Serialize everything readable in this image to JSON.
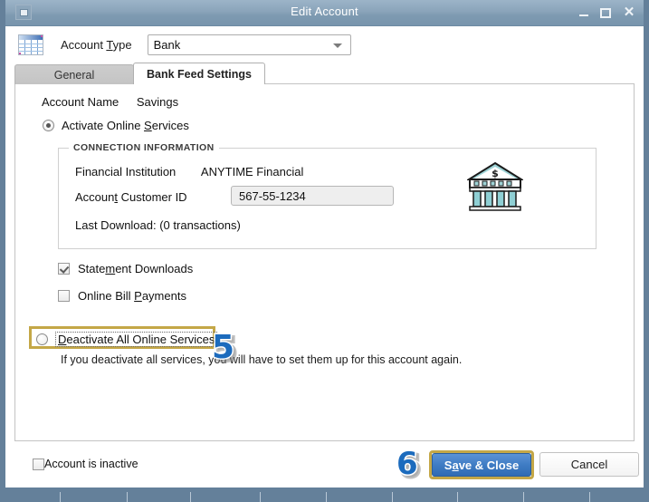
{
  "window": {
    "title": "Edit Account",
    "sysmenu_icon": "system-menu-icon",
    "minimize_label": "Minimize",
    "maximize_label": "Maximize",
    "close_label": "Close"
  },
  "account_type": {
    "icon": "account-grid-icon",
    "label": "Account Type",
    "label_prefix": "Account ",
    "label_accesskey": "T",
    "label_suffix": "ype",
    "value": "Bank",
    "caret_icon": "chevron-down-icon"
  },
  "tabs": [
    {
      "label": "General",
      "active": false
    },
    {
      "label": "Bank Feed Settings",
      "active": true
    }
  ],
  "content": {
    "account_name_label": "Account Name",
    "account_name_value": "Savings",
    "activate": {
      "label_prefix": "Activate Online ",
      "label_accesskey": "S",
      "label_suffix": "ervices",
      "checked": true
    },
    "connection": {
      "legend": "CONNECTION INFORMATION",
      "financial_institution_label": "Financial Institution",
      "financial_institution_value": "ANYTIME Financial",
      "account_customer_id_label_prefix": "Accoun",
      "account_customer_id_accesskey": "t",
      "account_customer_id_label_suffix": " Customer ID",
      "account_customer_id_value": "567-55-1234",
      "last_download_label": "Last Download:  (0 transactions)",
      "bank_icon": "bank-building-icon"
    },
    "statement_downloads": {
      "label_prefix": "State",
      "label_accesskey": "m",
      "label_suffix": "ent Downloads",
      "checked": true
    },
    "online_bill_payments": {
      "label_prefix": "Online Bill ",
      "label_accesskey": "P",
      "label_suffix": "ayments",
      "checked": false
    },
    "deactivate": {
      "label_prefix": "",
      "label_accesskey": "D",
      "label_suffix": "eactivate All Online Services",
      "checked": false
    },
    "hint": "If you deactivate all services, you will have to set them up for this account again."
  },
  "footer": {
    "account_inactive_label": "Account is inactive",
    "account_inactive_checked": false,
    "save_label_prefix": "S",
    "save_accesskey": "a",
    "save_label_suffix": "ve & Close",
    "cancel_label": "Cancel"
  },
  "callouts": {
    "step5": "5",
    "step6": "6"
  },
  "colors": {
    "titlebar": "#8aa4ba",
    "frame": "#64809a",
    "accent_gold": "#c4a747",
    "primary_button": "#3f7cc4",
    "badge_blue": "#1c6bbd"
  }
}
